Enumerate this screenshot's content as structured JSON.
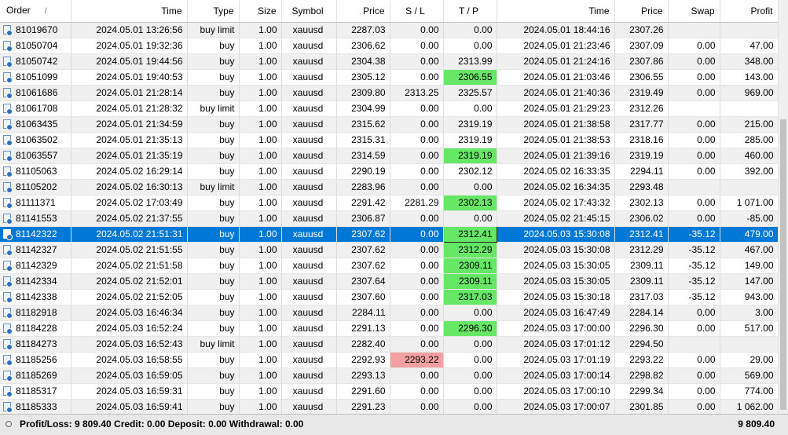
{
  "columns": [
    {
      "key": "order",
      "label": "Order",
      "sort_indicator": "/"
    },
    {
      "key": "open_time",
      "label": "Time"
    },
    {
      "key": "type",
      "label": "Type"
    },
    {
      "key": "size",
      "label": "Size"
    },
    {
      "key": "symbol",
      "label": "Symbol"
    },
    {
      "key": "open_price",
      "label": "Price"
    },
    {
      "key": "sl",
      "label": "S / L"
    },
    {
      "key": "tp",
      "label": "T / P"
    },
    {
      "key": "close_time",
      "label": "Time"
    },
    {
      "key": "close_price",
      "label": "Price"
    },
    {
      "key": "swap",
      "label": "Swap"
    },
    {
      "key": "profit",
      "label": "Profit"
    }
  ],
  "rows": [
    {
      "order": "81019670",
      "open_time": "2024.05.01 13:26:56",
      "type": "buy limit",
      "size": "1.00",
      "symbol": "xauusd",
      "open_price": "2287.03",
      "sl": "0.00",
      "tp": "0.00",
      "close_time": "2024.05.01 18:44:16",
      "close_price": "2307.26",
      "swap": "",
      "profit": ""
    },
    {
      "order": "81050704",
      "open_time": "2024.05.01 19:32:36",
      "type": "buy",
      "size": "1.00",
      "symbol": "xauusd",
      "open_price": "2306.62",
      "sl": "0.00",
      "tp": "0.00",
      "close_time": "2024.05.01 21:23:46",
      "close_price": "2307.09",
      "swap": "0.00",
      "profit": "47.00"
    },
    {
      "order": "81050742",
      "open_time": "2024.05.01 19:44:56",
      "type": "buy",
      "size": "1.00",
      "symbol": "xauusd",
      "open_price": "2304.38",
      "sl": "0.00",
      "tp": "2313.99",
      "close_time": "2024.05.01 21:24:16",
      "close_price": "2307.86",
      "swap": "0.00",
      "profit": "348.00"
    },
    {
      "order": "81051099",
      "open_time": "2024.05.01 19:40:53",
      "type": "buy",
      "size": "1.00",
      "symbol": "xauusd",
      "open_price": "2305.12",
      "sl": "0.00",
      "tp": "2306.55",
      "tp_hit": true,
      "close_time": "2024.05.01 21:03:46",
      "close_price": "2306.55",
      "swap": "0.00",
      "profit": "143.00"
    },
    {
      "order": "81061686",
      "open_time": "2024.05.01 21:28:14",
      "type": "buy",
      "size": "1.00",
      "symbol": "xauusd",
      "open_price": "2309.80",
      "sl": "2313.25",
      "tp": "2325.57",
      "close_time": "2024.05.01 21:40:36",
      "close_price": "2319.49",
      "swap": "0.00",
      "profit": "969.00"
    },
    {
      "order": "81061708",
      "open_time": "2024.05.01 21:28:32",
      "type": "buy limit",
      "size": "1.00",
      "symbol": "xauusd",
      "open_price": "2304.99",
      "sl": "0.00",
      "tp": "0.00",
      "close_time": "2024.05.01 21:29:23",
      "close_price": "2312.26",
      "swap": "",
      "profit": ""
    },
    {
      "order": "81063435",
      "open_time": "2024.05.01 21:34:59",
      "type": "buy",
      "size": "1.00",
      "symbol": "xauusd",
      "open_price": "2315.62",
      "sl": "0.00",
      "tp": "2319.19",
      "close_time": "2024.05.01 21:38:58",
      "close_price": "2317.77",
      "swap": "0.00",
      "profit": "215.00"
    },
    {
      "order": "81063502",
      "open_time": "2024.05.01 21:35:13",
      "type": "buy",
      "size": "1.00",
      "symbol": "xauusd",
      "open_price": "2315.31",
      "sl": "0.00",
      "tp": "2319.19",
      "close_time": "2024.05.01 21:38:53",
      "close_price": "2318.16",
      "swap": "0.00",
      "profit": "285.00"
    },
    {
      "order": "81063557",
      "open_time": "2024.05.01 21:35:19",
      "type": "buy",
      "size": "1.00",
      "symbol": "xauusd",
      "open_price": "2314.59",
      "sl": "0.00",
      "tp": "2319.19",
      "tp_hit": true,
      "close_time": "2024.05.01 21:39:16",
      "close_price": "2319.19",
      "swap": "0.00",
      "profit": "460.00"
    },
    {
      "order": "81105063",
      "open_time": "2024.05.02 16:29:14",
      "type": "buy",
      "size": "1.00",
      "symbol": "xauusd",
      "open_price": "2290.19",
      "sl": "0.00",
      "tp": "2302.12",
      "close_time": "2024.05.02 16:33:35",
      "close_price": "2294.11",
      "swap": "0.00",
      "profit": "392.00"
    },
    {
      "order": "81105202",
      "open_time": "2024.05.02 16:30:13",
      "type": "buy limit",
      "size": "1.00",
      "symbol": "xauusd",
      "open_price": "2283.96",
      "sl": "0.00",
      "tp": "0.00",
      "close_time": "2024.05.02 16:34:35",
      "close_price": "2293.48",
      "swap": "",
      "profit": ""
    },
    {
      "order": "81111371",
      "open_time": "2024.05.02 17:03:49",
      "type": "buy",
      "size": "1.00",
      "symbol": "xauusd",
      "open_price": "2291.42",
      "sl": "2281.29",
      "tp": "2302.13",
      "tp_hit": true,
      "close_time": "2024.05.02 17:43:32",
      "close_price": "2302.13",
      "swap": "0.00",
      "profit": "1 071.00"
    },
    {
      "order": "81141553",
      "open_time": "2024.05.02 21:37:55",
      "type": "buy",
      "size": "1.00",
      "symbol": "xauusd",
      "open_price": "2306.87",
      "sl": "0.00",
      "tp": "0.00",
      "close_time": "2024.05.02 21:45:15",
      "close_price": "2306.02",
      "swap": "0.00",
      "profit": "-85.00"
    },
    {
      "order": "81142322",
      "open_time": "2024.05.02 21:51:31",
      "type": "buy",
      "size": "1.00",
      "symbol": "xauusd",
      "open_price": "2307.62",
      "sl": "0.00",
      "tp": "2312.41",
      "tp_hit": true,
      "selected": true,
      "close_time": "2024.05.03 15:30:08",
      "close_price": "2312.41",
      "swap": "-35.12",
      "profit": "479.00"
    },
    {
      "order": "81142327",
      "open_time": "2024.05.02 21:51:55",
      "type": "buy",
      "size": "1.00",
      "symbol": "xauusd",
      "open_price": "2307.62",
      "sl": "0.00",
      "tp": "2312.29",
      "tp_hit": true,
      "close_time": "2024.05.03 15:30:08",
      "close_price": "2312.29",
      "swap": "-35.12",
      "profit": "467.00"
    },
    {
      "order": "81142329",
      "open_time": "2024.05.02 21:51:58",
      "type": "buy",
      "size": "1.00",
      "symbol": "xauusd",
      "open_price": "2307.62",
      "sl": "0.00",
      "tp": "2309.11",
      "tp_hit": true,
      "close_time": "2024.05.03 15:30:05",
      "close_price": "2309.11",
      "swap": "-35.12",
      "profit": "149.00"
    },
    {
      "order": "81142334",
      "open_time": "2024.05.02 21:52:01",
      "type": "buy",
      "size": "1.00",
      "symbol": "xauusd",
      "open_price": "2307.64",
      "sl": "0.00",
      "tp": "2309.11",
      "tp_hit": true,
      "close_time": "2024.05.03 15:30:05",
      "close_price": "2309.11",
      "swap": "-35.12",
      "profit": "147.00"
    },
    {
      "order": "81142338",
      "open_time": "2024.05.02 21:52:05",
      "type": "buy",
      "size": "1.00",
      "symbol": "xauusd",
      "open_price": "2307.60",
      "sl": "0.00",
      "tp": "2317.03",
      "tp_hit": true,
      "close_time": "2024.05.03 15:30:18",
      "close_price": "2317.03",
      "swap": "-35.12",
      "profit": "943.00"
    },
    {
      "order": "81182918",
      "open_time": "2024.05.03 16:46:34",
      "type": "buy",
      "size": "1.00",
      "symbol": "xauusd",
      "open_price": "2284.11",
      "sl": "0.00",
      "tp": "0.00",
      "close_time": "2024.05.03 16:47:49",
      "close_price": "2284.14",
      "swap": "0.00",
      "profit": "3.00"
    },
    {
      "order": "81184228",
      "open_time": "2024.05.03 16:52:24",
      "type": "buy",
      "size": "1.00",
      "symbol": "xauusd",
      "open_price": "2291.13",
      "sl": "0.00",
      "tp": "2296.30",
      "tp_hit": true,
      "close_time": "2024.05.03 17:00:00",
      "close_price": "2296.30",
      "swap": "0.00",
      "profit": "517.00"
    },
    {
      "order": "81184273",
      "open_time": "2024.05.03 16:52:43",
      "type": "buy limit",
      "size": "1.00",
      "symbol": "xauusd",
      "open_price": "2282.40",
      "sl": "0.00",
      "tp": "0.00",
      "close_time": "2024.05.03 17:01:12",
      "close_price": "2294.50",
      "swap": "",
      "profit": ""
    },
    {
      "order": "81185256",
      "open_time": "2024.05.03 16:58:55",
      "type": "buy",
      "size": "1.00",
      "symbol": "xauusd",
      "open_price": "2292.93",
      "sl": "2293.22",
      "sl_hit": true,
      "tp": "0.00",
      "close_time": "2024.05.03 17:01:19",
      "close_price": "2293.22",
      "swap": "0.00",
      "profit": "29.00"
    },
    {
      "order": "81185269",
      "open_time": "2024.05.03 16:59:05",
      "type": "buy",
      "size": "1.00",
      "symbol": "xauusd",
      "open_price": "2293.13",
      "sl": "0.00",
      "tp": "0.00",
      "close_time": "2024.05.03 17:00:14",
      "close_price": "2298.82",
      "swap": "0.00",
      "profit": "569.00"
    },
    {
      "order": "81185317",
      "open_time": "2024.05.03 16:59:31",
      "type": "buy",
      "size": "1.00",
      "symbol": "xauusd",
      "open_price": "2291.60",
      "sl": "0.00",
      "tp": "0.00",
      "close_time": "2024.05.03 17:00:10",
      "close_price": "2299.34",
      "swap": "0.00",
      "profit": "774.00"
    },
    {
      "order": "81185333",
      "open_time": "2024.05.03 16:59:41",
      "type": "buy",
      "size": "1.00",
      "symbol": "xauusd",
      "open_price": "2291.23",
      "sl": "0.00",
      "tp": "0.00",
      "close_time": "2024.05.03 17:00:07",
      "close_price": "2301.85",
      "swap": "0.00",
      "profit": "1 062.00"
    }
  ],
  "summary": {
    "text": "Profit/Loss: 9 809.40  Credit: 0.00  Deposit: 0.00  Withdrawal: 0.00",
    "total": "9 809.40"
  },
  "colors": {
    "selected_row": "#0078d7",
    "tp_hit": "#66e866",
    "sl_hit": "#f4a0a0",
    "row_alt": "#f0f0f0"
  },
  "icons": {
    "row_icon": "order-document-icon",
    "summary_icon": "circle-icon"
  }
}
